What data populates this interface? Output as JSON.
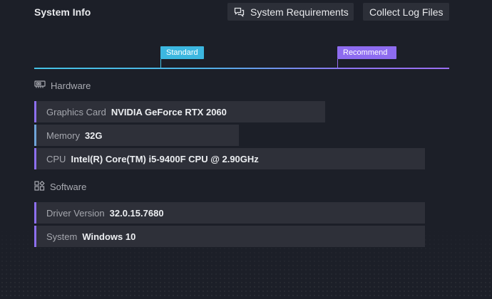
{
  "header": {
    "title": "System Info",
    "requirements_label": "System Requirements",
    "logs_label": "Collect Log Files"
  },
  "scale": {
    "standard_label": "Standard",
    "recommend_label": "Recommend",
    "colors": {
      "standard": "#3cb7e0",
      "recommend": "#8e6cf0"
    }
  },
  "hardware": {
    "title": "Hardware",
    "rows": [
      {
        "key": "Graphics Card",
        "value": "NVIDIA GeForce RTX 2060",
        "level": "recommend"
      },
      {
        "key": "Memory",
        "value": "32G",
        "level": "standard"
      },
      {
        "key": "CPU",
        "value": "Intel(R) Core(TM) i5-9400F CPU @ 2.90GHz",
        "level": "recommend"
      }
    ]
  },
  "software": {
    "title": "Software",
    "rows": [
      {
        "key": "Driver Version",
        "value": "32.0.15.7680",
        "level": "recommend"
      },
      {
        "key": "System",
        "value": "Windows 10",
        "level": "recommend"
      }
    ]
  },
  "icons": {
    "requirements": "chat-bubbles-icon",
    "hardware": "memory-chip-icon",
    "software": "apps-grid-icon"
  }
}
